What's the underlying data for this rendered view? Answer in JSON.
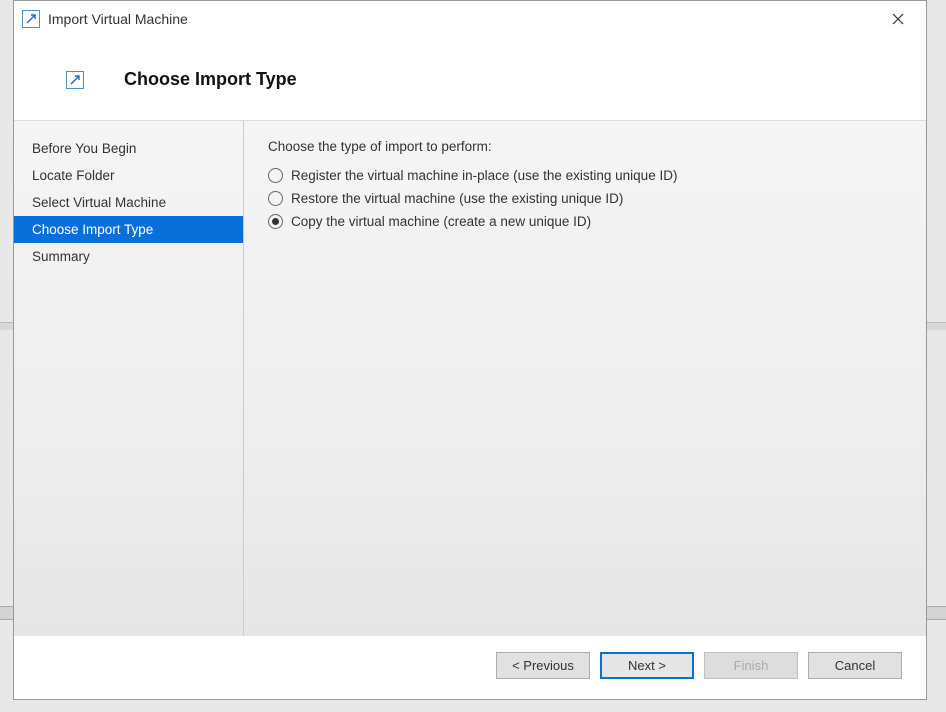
{
  "window": {
    "title": "Import Virtual Machine"
  },
  "header": {
    "title": "Choose Import Type"
  },
  "sidebar": {
    "items": [
      {
        "label": "Before You Begin",
        "active": false
      },
      {
        "label": "Locate Folder",
        "active": false
      },
      {
        "label": "Select Virtual Machine",
        "active": false
      },
      {
        "label": "Choose Import Type",
        "active": true
      },
      {
        "label": "Summary",
        "active": false
      }
    ]
  },
  "content": {
    "prompt": "Choose the type of import to perform:",
    "options": [
      {
        "label": "Register the virtual machine in-place (use the existing unique ID)",
        "selected": false
      },
      {
        "label": "Restore the virtual machine (use the existing unique ID)",
        "selected": false
      },
      {
        "label": "Copy the virtual machine (create a new unique ID)",
        "selected": true
      }
    ]
  },
  "footer": {
    "previous": "< Previous",
    "next": "Next >",
    "finish": "Finish",
    "cancel": "Cancel"
  }
}
